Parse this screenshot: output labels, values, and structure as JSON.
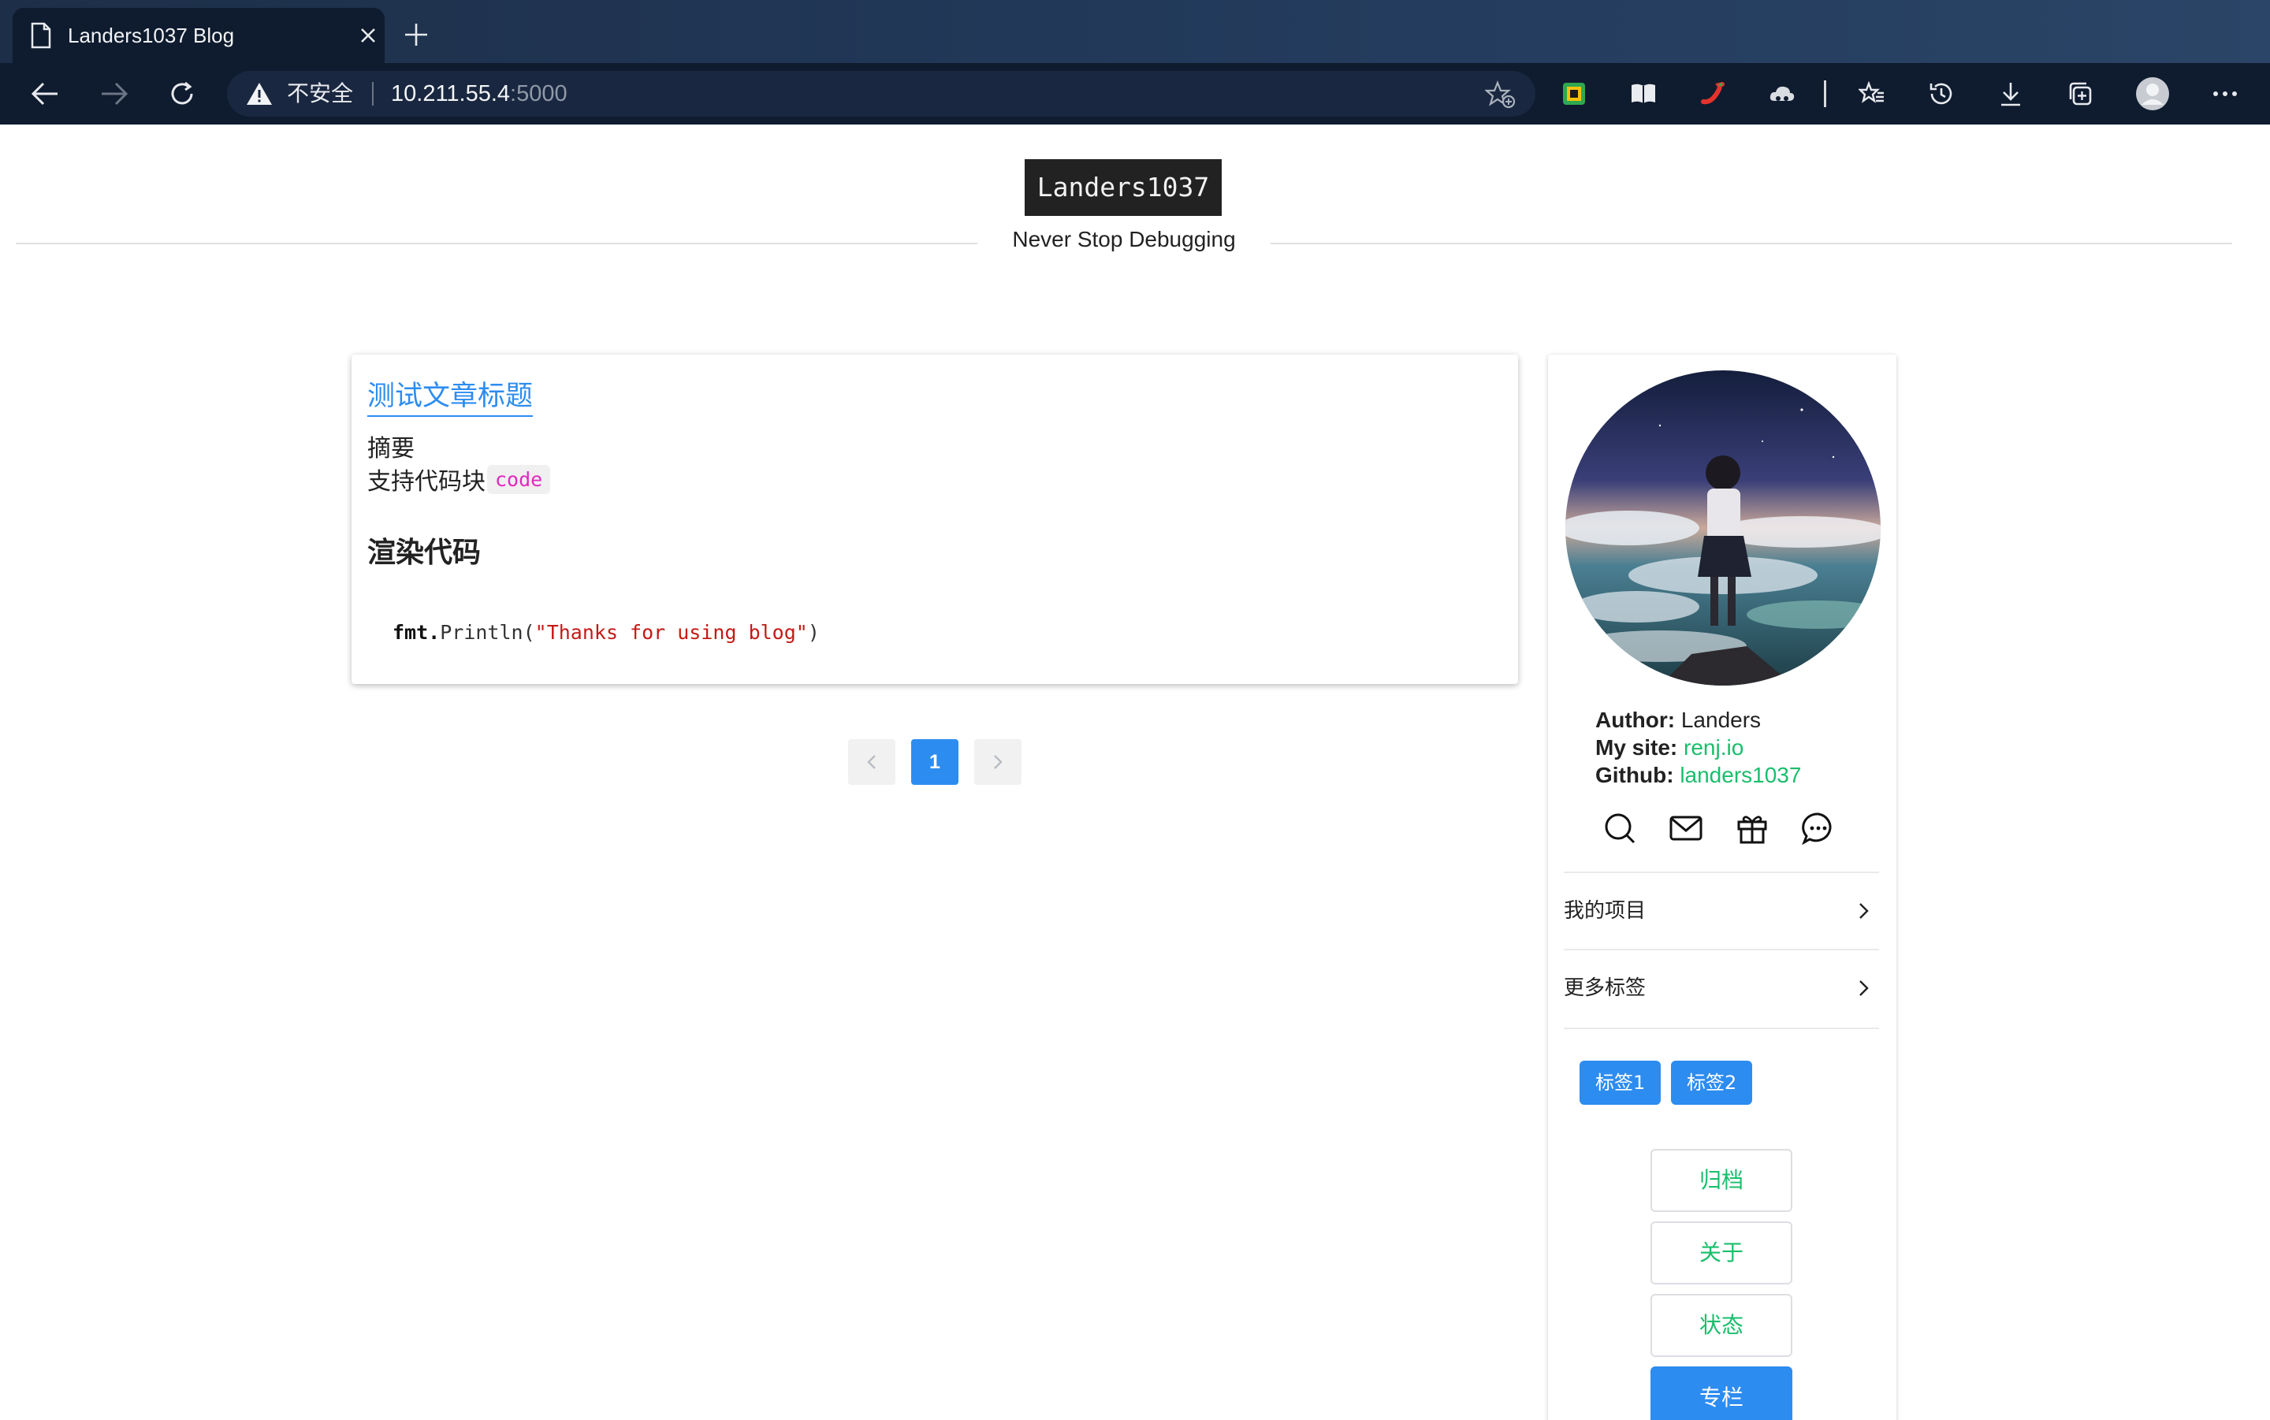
{
  "browser": {
    "tab_title": "Landers1037 Blog",
    "security_label": "不安全",
    "url_host": "10.211.55.4",
    "url_port": ":5000"
  },
  "site": {
    "logo": "Landers1037",
    "tagline": "Never Stop Debugging"
  },
  "post": {
    "title": "测试文章标题",
    "summary": "摘要",
    "support_text": "支持代码块",
    "inline_code": "code",
    "heading": "渲染代码",
    "code_fmt": "fmt.",
    "code_call": "Println(",
    "code_string": "\"Thanks for using blog\"",
    "code_close": ")"
  },
  "pagination": {
    "current": "1"
  },
  "sidebar": {
    "author_label": "Author:",
    "author": "Landers",
    "site_label": "My site:",
    "site": "renj.io",
    "github_label": "Github:",
    "github": "landers1037",
    "menu": [
      {
        "label": "我的项目"
      },
      {
        "label": "更多标签"
      }
    ],
    "tags": [
      "标签1",
      "标签2"
    ],
    "buttons": [
      "归档",
      "关于",
      "状态",
      "专栏"
    ]
  },
  "colors": {
    "accent": "#2d8cf0",
    "link_green": "#19be6b",
    "chrome_bg": "#0f1b2e"
  }
}
